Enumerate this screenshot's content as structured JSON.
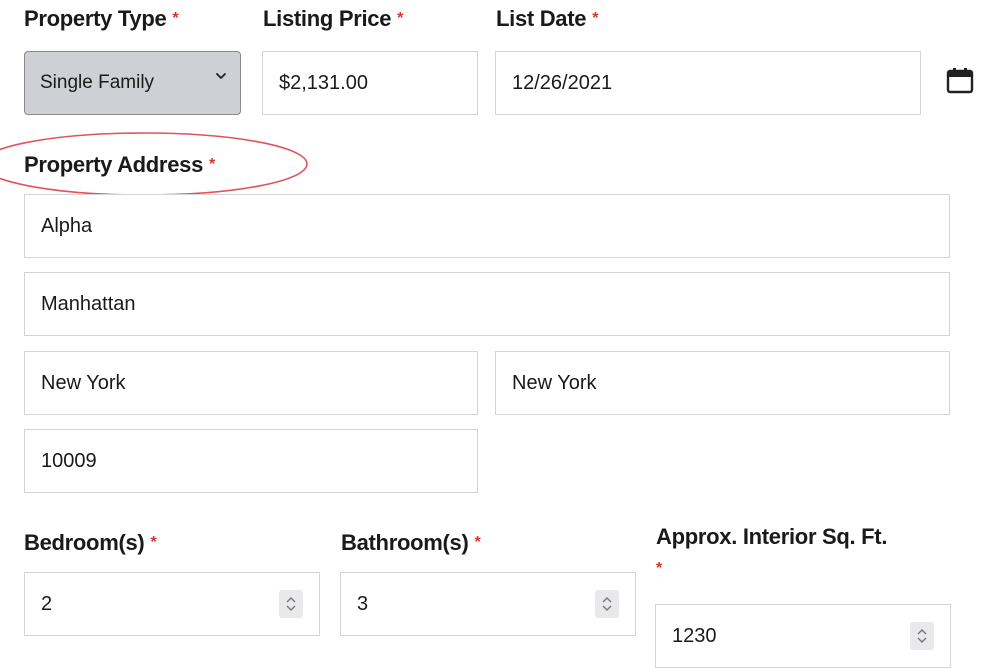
{
  "required_mark": "*",
  "property_type": {
    "label": "Property Type",
    "value": "Single Family"
  },
  "listing_price": {
    "label": "Listing Price",
    "value": "$2,131.00"
  },
  "list_date": {
    "label": "List Date",
    "value": "12/26/2021"
  },
  "address": {
    "label": "Property Address",
    "street": "Alpha",
    "line2": "Manhattan",
    "city": "New York",
    "state": "New York",
    "zip": "10009"
  },
  "bedrooms": {
    "label": "Bedroom(s)",
    "value": "2"
  },
  "bathrooms": {
    "label": "Bathroom(s)",
    "value": "3"
  },
  "sqft": {
    "label": "Approx. Interior Sq. Ft.",
    "value": "1230"
  },
  "icons": {
    "calendar": "calendar-icon",
    "select_chevron": "chevron-down-icon",
    "stepper": "spinner-arrows-icon"
  },
  "colors": {
    "required": "#d9342b",
    "annotation_circle": "#e0525e",
    "select_bg": "#cfd0d6",
    "border": "#d4d4d4"
  }
}
